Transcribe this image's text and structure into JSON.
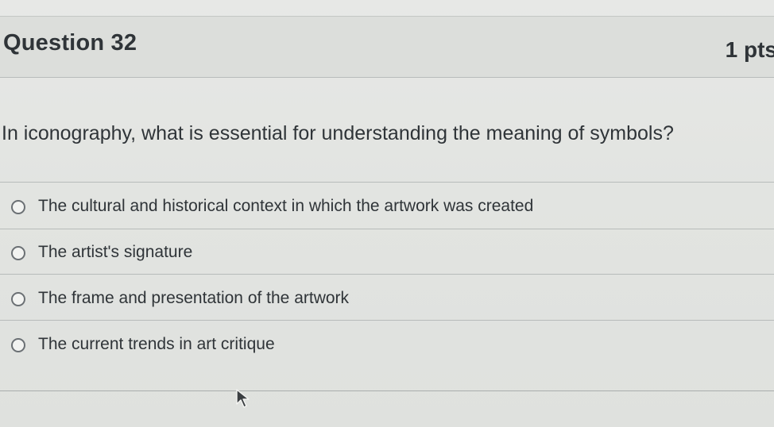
{
  "question": {
    "title": "Question 32",
    "points": "1 pts",
    "text": "In iconography, what is essential for understanding the meaning of symbols?"
  },
  "answers": [
    {
      "label": "The cultural and historical context in which the artwork was created",
      "selected": false
    },
    {
      "label": "The artist's signature",
      "selected": false
    },
    {
      "label": "The frame and presentation of the artwork",
      "selected": false
    },
    {
      "label": "The current trends in art critique",
      "selected": false
    }
  ],
  "icons": {
    "radio": "radio-empty",
    "cursor": "mouse-pointer-icon"
  },
  "colors": {
    "text": "#2f3438",
    "background": "#e4e6e3",
    "divider": "#b7bbba"
  }
}
